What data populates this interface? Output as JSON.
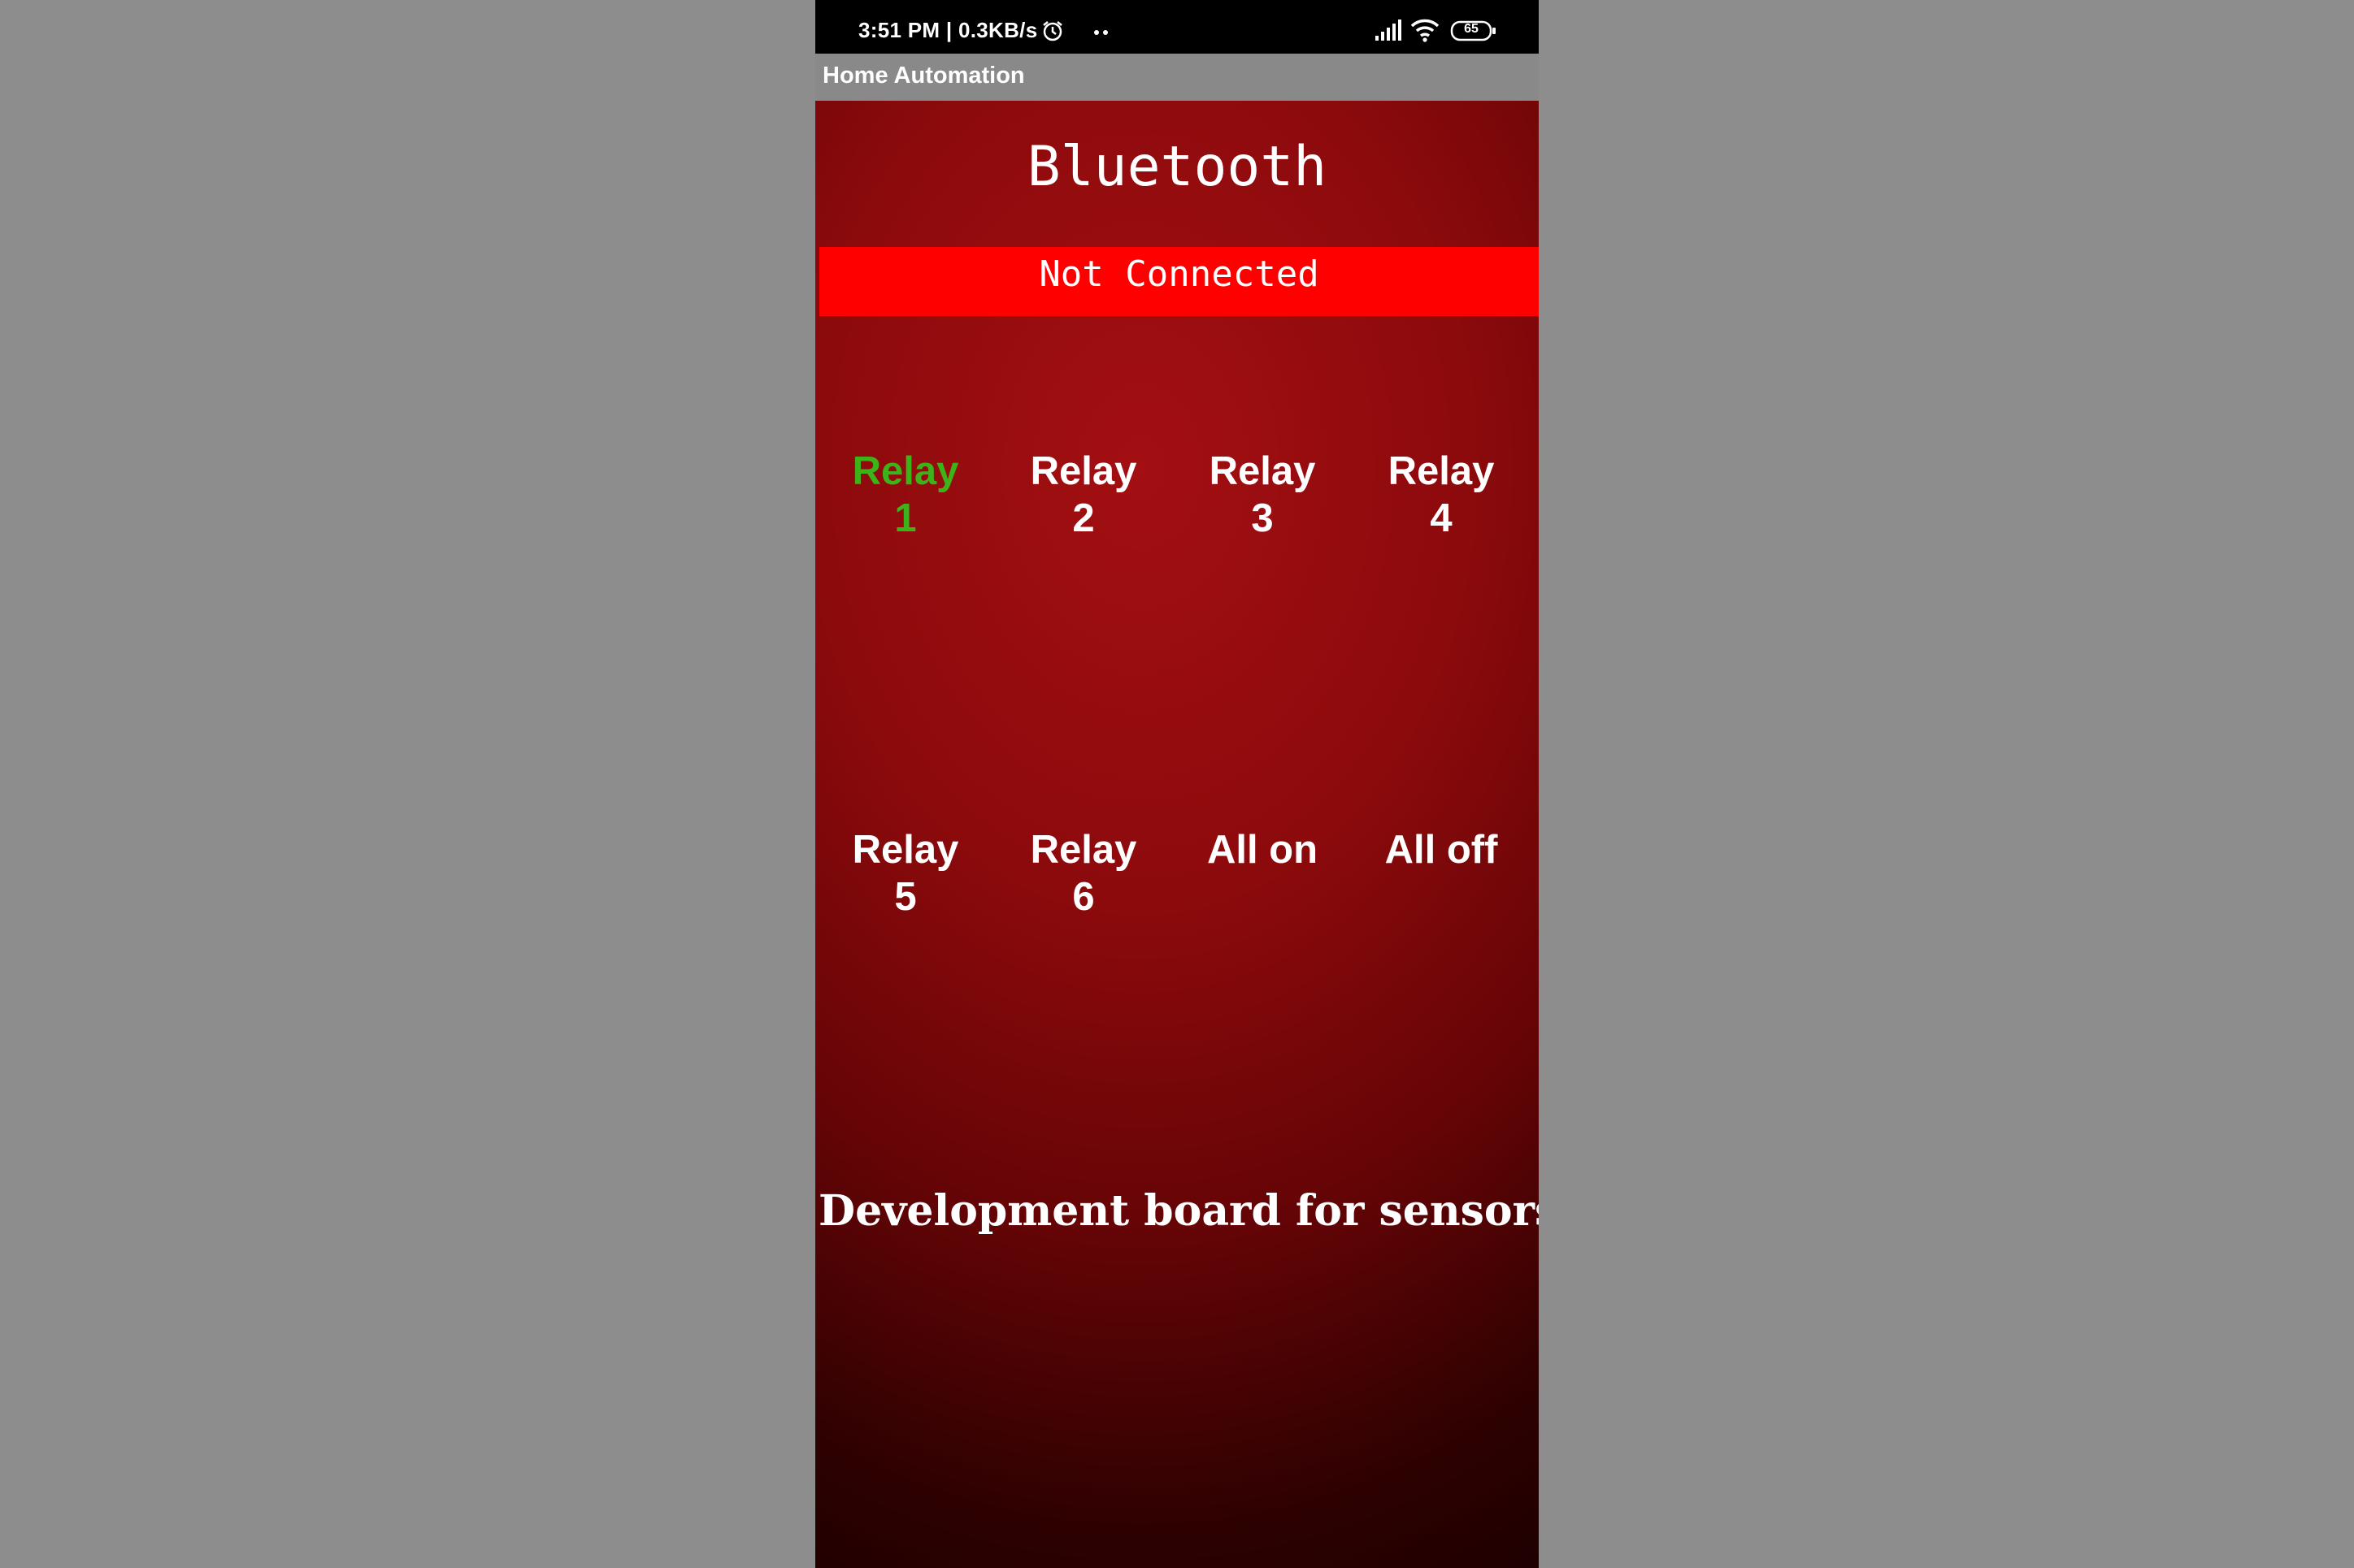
{
  "status_bar": {
    "time_speed": "3:51 PM | 0.3KB/s",
    "battery": "65"
  },
  "app_bar": {
    "title": "Home Automation"
  },
  "main": {
    "heading": "Bluetooth",
    "connection_status": "Not Connected",
    "buttons": [
      {
        "line1": "Relay",
        "line2": "1",
        "active": true
      },
      {
        "line1": "Relay",
        "line2": "2",
        "active": false
      },
      {
        "line1": "Relay",
        "line2": "3",
        "active": false
      },
      {
        "line1": "Relay",
        "line2": "4",
        "active": false
      },
      {
        "line1": "Relay",
        "line2": "5",
        "active": false
      },
      {
        "line1": "Relay",
        "line2": "6",
        "active": false
      },
      {
        "line1": "All on",
        "line2": "",
        "active": false
      },
      {
        "line1": "All off",
        "line2": "",
        "active": false
      }
    ],
    "footer": "Development board for sensors"
  },
  "colors": {
    "active_relay": "#3db31a",
    "status_banner": "#ff0000",
    "app_bar": "#898989",
    "background_outer": "#8d8d8d"
  }
}
